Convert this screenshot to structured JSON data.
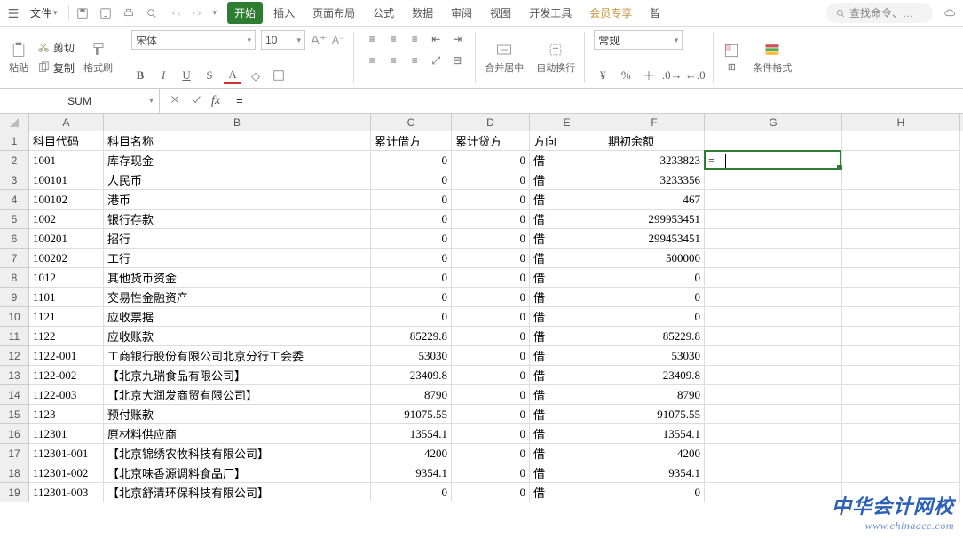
{
  "menu": {
    "file": "文件",
    "search_placeholder": "查找命令、…"
  },
  "tabs": {
    "start": "开始",
    "insert": "插入",
    "layout": "页面布局",
    "formula": "公式",
    "data": "数据",
    "review": "审阅",
    "view": "视图",
    "dev": "开发工具",
    "vip": "会员专享",
    "more": "智"
  },
  "ribbon": {
    "paste": "粘贴",
    "cut": "剪切",
    "copy": "复制",
    "fmtpaint": "格式刷",
    "font_name": "宋体",
    "font_size": "10",
    "merge": "合并居中",
    "wrap": "自动换行",
    "numfmt": "常规",
    "condfmt": "条件格式"
  },
  "namebox": "SUM",
  "formula": "=",
  "col_widths": {
    "A": 84,
    "B": 301,
    "C": 91,
    "D": 88,
    "E": 84,
    "F": 113,
    "G": 155,
    "H": 133
  },
  "columns": [
    "A",
    "B",
    "C",
    "D",
    "E",
    "F",
    "G",
    "H"
  ],
  "header_row": {
    "A": "科目代码",
    "B": "科目名称",
    "C": "累计借方",
    "D": "累计贷方",
    "E": "方向",
    "F": "期初余额"
  },
  "rows": [
    {
      "n": 2,
      "A": "1001",
      "B": "库存现金",
      "C": "0",
      "D": "0",
      "E": "借",
      "F": "3233823"
    },
    {
      "n": 3,
      "A": "100101",
      "B": "人民币",
      "C": "0",
      "D": "0",
      "E": "借",
      "F": "3233356"
    },
    {
      "n": 4,
      "A": "100102",
      "B": "港币",
      "C": "0",
      "D": "0",
      "E": "借",
      "F": "467"
    },
    {
      "n": 5,
      "A": "1002",
      "B": "银行存款",
      "C": "0",
      "D": "0",
      "E": "借",
      "F": "299953451"
    },
    {
      "n": 6,
      "A": "100201",
      "B": "招行",
      "C": "0",
      "D": "0",
      "E": "借",
      "F": "299453451"
    },
    {
      "n": 7,
      "A": "100202",
      "B": "工行",
      "C": "0",
      "D": "0",
      "E": "借",
      "F": "500000"
    },
    {
      "n": 8,
      "A": "1012",
      "B": "其他货币资金",
      "C": "0",
      "D": "0",
      "E": "借",
      "F": "0"
    },
    {
      "n": 9,
      "A": "1101",
      "B": "交易性金融资产",
      "C": "0",
      "D": "0",
      "E": "借",
      "F": "0"
    },
    {
      "n": 10,
      "A": "1121",
      "B": "应收票据",
      "C": "0",
      "D": "0",
      "E": "借",
      "F": "0"
    },
    {
      "n": 11,
      "A": "1122",
      "B": "应收账款",
      "C": "85229.8",
      "D": "0",
      "E": "借",
      "F": "85229.8"
    },
    {
      "n": 12,
      "A": "1122-001",
      "B": "工商银行股份有限公司北京分行工会委",
      "C": "53030",
      "D": "0",
      "E": "借",
      "F": "53030"
    },
    {
      "n": 13,
      "A": "1122-002",
      "B": "【北京九瑞食品有限公司】",
      "C": "23409.8",
      "D": "0",
      "E": "借",
      "F": "23409.8"
    },
    {
      "n": 14,
      "A": "1122-003",
      "B": "【北京大润发商贸有限公司】",
      "C": "8790",
      "D": "0",
      "E": "借",
      "F": "8790"
    },
    {
      "n": 15,
      "A": "1123",
      "B": "预付账款",
      "C": "91075.55",
      "D": "0",
      "E": "借",
      "F": "91075.55"
    },
    {
      "n": 16,
      "A": "112301",
      "B": "原材料供应商",
      "C": "13554.1",
      "D": "0",
      "E": "借",
      "F": "13554.1"
    },
    {
      "n": 17,
      "A": "112301-001",
      "B": "【北京锦绣农牧科技有限公司】",
      "C": "4200",
      "D": "0",
      "E": "借",
      "F": "4200"
    },
    {
      "n": 18,
      "A": "112301-002",
      "B": "【北京味香源调料食品厂】",
      "C": "9354.1",
      "D": "0",
      "E": "借",
      "F": "9354.1"
    },
    {
      "n": 19,
      "A": "112301-003",
      "B": "【北京舒清环保科技有限公司】",
      "C": "0",
      "D": "0",
      "E": "借",
      "F": "0"
    }
  ],
  "active": {
    "cell": "G2",
    "content": "="
  },
  "watermark": {
    "title": "中华会计网校",
    "url": "www.chinaacc.com"
  }
}
